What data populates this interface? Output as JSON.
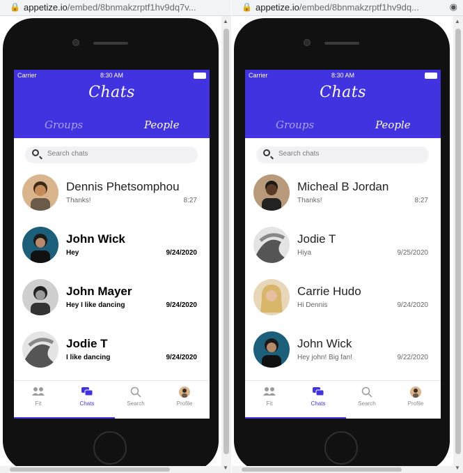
{
  "browser": {
    "url_host": "appetize.io",
    "url_path_left": "/embed/8bnmakzrptf1hv9dq7v...",
    "url_path_right": "/embed/8bnmakzrptf1hv9dq..."
  },
  "accent_color": "#4133e0",
  "screens": [
    {
      "status": {
        "carrier": "Carrier",
        "time": "8:30 AM"
      },
      "title": "Chats",
      "tabs": [
        "Groups",
        "People"
      ],
      "active_tab": "People",
      "search_placeholder": "Search chats",
      "chats": [
        {
          "name": "Dennis Phetsomphou",
          "message": "Thanks!",
          "date": "8:27",
          "unread": false
        },
        {
          "name": "John Wick",
          "message": "Hey",
          "date": "9/24/2020",
          "unread": true
        },
        {
          "name": "John Mayer",
          "message": "Hey I like dancing",
          "date": "9/24/2020",
          "unread": true
        },
        {
          "name": "Jodie T",
          "message": "I like dancing",
          "date": "9/24/2020",
          "unread": true
        }
      ],
      "tabbar": [
        {
          "label": "Fit",
          "icon": "people-icon"
        },
        {
          "label": "Chats",
          "icon": "chat-bubbles-icon",
          "active": true
        },
        {
          "label": "Search",
          "icon": "search-icon"
        },
        {
          "label": "Profile",
          "icon": "avatar"
        }
      ]
    },
    {
      "status": {
        "carrier": "Carrier",
        "time": "8:30 AM"
      },
      "title": "Chats",
      "tabs": [
        "Groups",
        "People"
      ],
      "active_tab": "People",
      "search_placeholder": "Search chats",
      "chats": [
        {
          "name": "Micheal B Jordan",
          "message": "Thanks!",
          "date": "8:27",
          "unread": false
        },
        {
          "name": "Jodie T",
          "message": "Hiya",
          "date": "9/25/2020",
          "unread": false
        },
        {
          "name": "Carrie Hudo",
          "message": "Hi Dennis",
          "date": "9/24/2020",
          "unread": false
        },
        {
          "name": "John Wick",
          "message": "Hey john! Big fan!",
          "date": "9/22/2020",
          "unread": false
        }
      ],
      "tabbar": [
        {
          "label": "Fit",
          "icon": "people-icon"
        },
        {
          "label": "Chats",
          "icon": "chat-bubbles-icon",
          "active": true
        },
        {
          "label": "Search",
          "icon": "search-icon"
        },
        {
          "label": "Profile",
          "icon": "avatar"
        }
      ]
    }
  ]
}
